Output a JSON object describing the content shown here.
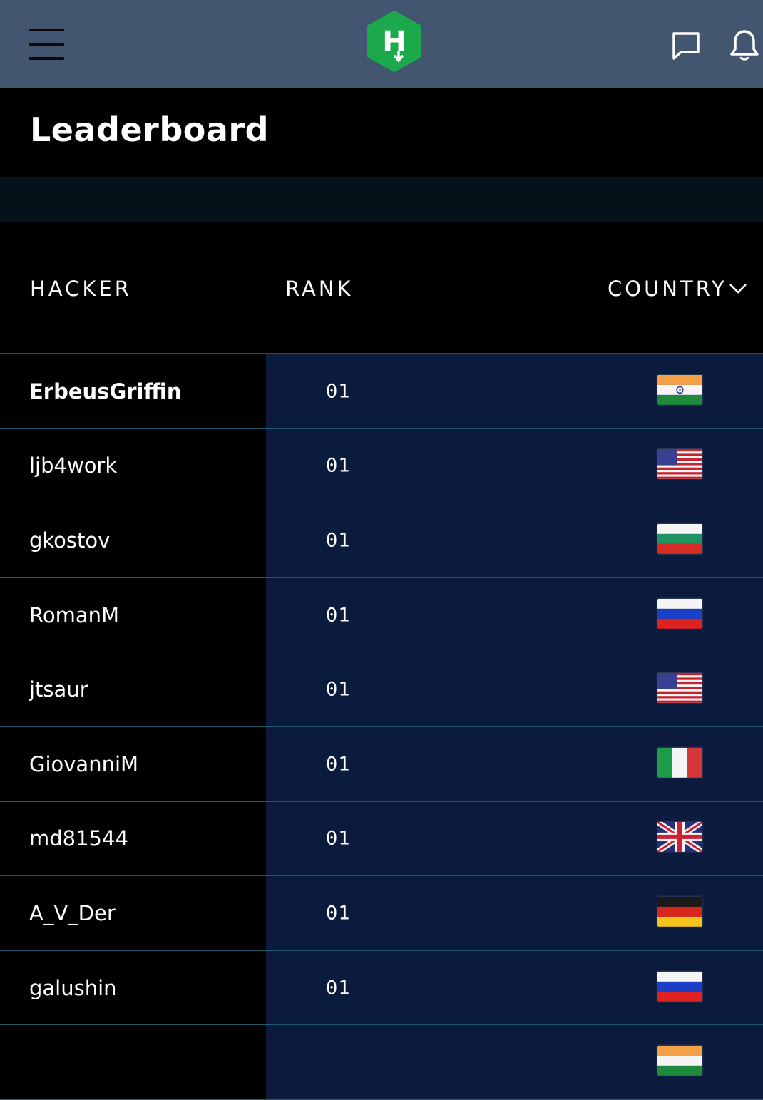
{
  "header": {
    "menu_icon": "hamburger-menu-icon",
    "logo_icon": "hackerrank-logo-icon",
    "logo_letter": "H",
    "chat_icon": "chat-icon",
    "bell_icon": "bell-icon",
    "logo_color": "#1ba94c"
  },
  "page": {
    "title": "Leaderboard"
  },
  "table": {
    "columns": {
      "hacker": "HACKER",
      "rank": "RANK",
      "country": "COUNTRY"
    },
    "rows": [
      {
        "hacker": "ErbeusGriffin",
        "rank": "01",
        "country_flag": "india-flag-icon"
      },
      {
        "hacker": "ljb4work",
        "rank": "01",
        "country_flag": "usa-flag-icon"
      },
      {
        "hacker": "gkostov",
        "rank": "01",
        "country_flag": "bulgaria-flag-icon"
      },
      {
        "hacker": "RomanM",
        "rank": "01",
        "country_flag": "russia-flag-icon"
      },
      {
        "hacker": "jtsaur",
        "rank": "01",
        "country_flag": "usa-flag-icon"
      },
      {
        "hacker": "GiovanniM",
        "rank": "01",
        "country_flag": "italy-flag-icon"
      },
      {
        "hacker": "md81544",
        "rank": "01",
        "country_flag": "uk-flag-icon"
      },
      {
        "hacker": "A_V_Der",
        "rank": "01",
        "country_flag": "germany-flag-icon"
      },
      {
        "hacker": "galushin",
        "rank": "01",
        "country_flag": "russia-flag-icon"
      },
      {
        "hacker": "",
        "rank": "",
        "country_flag": "india-flag-icon"
      }
    ]
  },
  "colors": {
    "topbar": "#43566f",
    "row_bg": "#0a1b3d",
    "divider": "#23566a"
  }
}
